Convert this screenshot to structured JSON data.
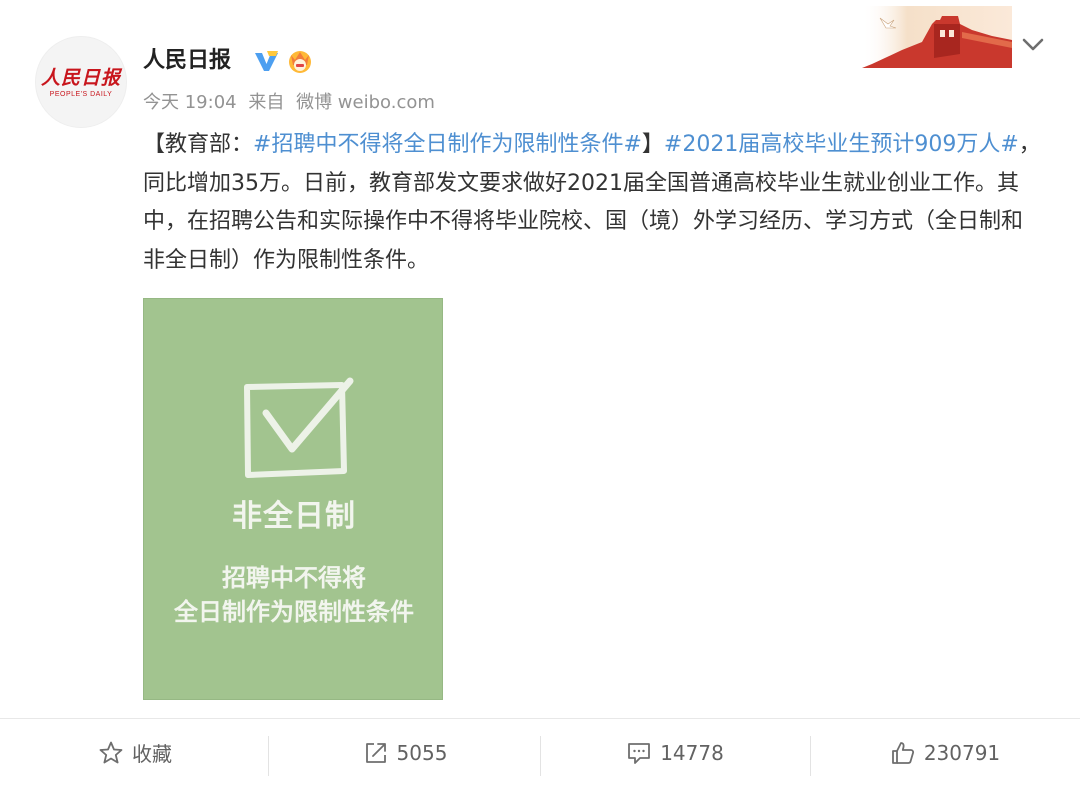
{
  "post": {
    "author": {
      "name": "人民日报",
      "avatar_logo_text": "人民日报",
      "avatar_logo_sub": "PEOPLE'S DAILY",
      "verified_icon": "verified-v-icon",
      "vip_icon": "vip-crown-icon"
    },
    "meta": {
      "time": "今天 19:04",
      "source_prefix": "来自",
      "source": "微博 weibo.com"
    },
    "content": {
      "bracket_open": "【",
      "prefix": "教育部：",
      "topic1": "#招聘中不得将全日制作为限制性条件#",
      "bracket_close": "】",
      "topic2": "#2021届高校毕业生预计909万人#",
      "body": "，同比增加35万。日前，教育部发文要求做好2021届全国普通高校毕业生就业创业工作。其中，在招聘公告和实际操作中不得将毕业院校、国（境）外学习经历、学习方式（全日制和非全日制）作为限制性条件。"
    },
    "image": {
      "title": "非全日制",
      "caption_line1": "招聘中不得将",
      "caption_line2": "全日制作为限制性条件",
      "background_color": "#a2c48f"
    }
  },
  "actions": {
    "favorite": {
      "label": "收藏",
      "icon": "star-icon"
    },
    "repost": {
      "count": "5055",
      "icon": "share-icon"
    },
    "comment": {
      "count": "14778",
      "icon": "comment-icon"
    },
    "like": {
      "count": "230791",
      "icon": "thumbs-up-icon"
    }
  },
  "colors": {
    "topic_link": "#4e8fd1",
    "meta_text": "#939393",
    "brand_red": "#c8161d"
  }
}
